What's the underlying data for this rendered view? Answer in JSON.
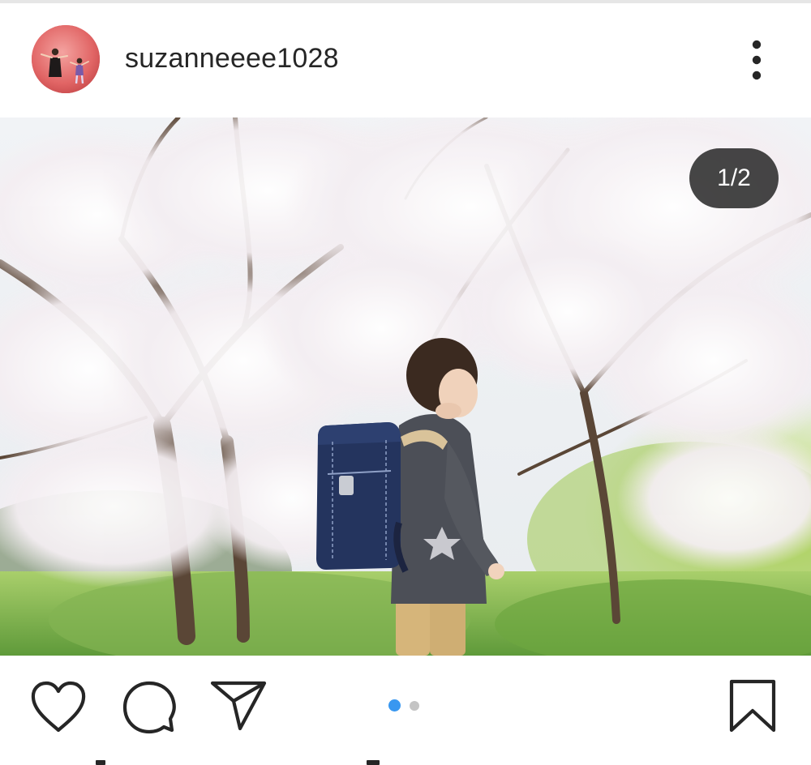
{
  "post": {
    "username": "suzanneeee1028",
    "page_counter": "1/2",
    "carousel": {
      "current": 1,
      "total": 2
    },
    "colors": {
      "text": "#262626",
      "dot_active": "#3897f0",
      "dot_inactive": "#c4c4c4",
      "counter_bg": "#262626"
    }
  },
  "icons": {
    "more": "more-vertical-icon",
    "like": "heart-icon",
    "comment": "comment-bubble-icon",
    "share": "paper-plane-icon",
    "save": "bookmark-icon"
  }
}
